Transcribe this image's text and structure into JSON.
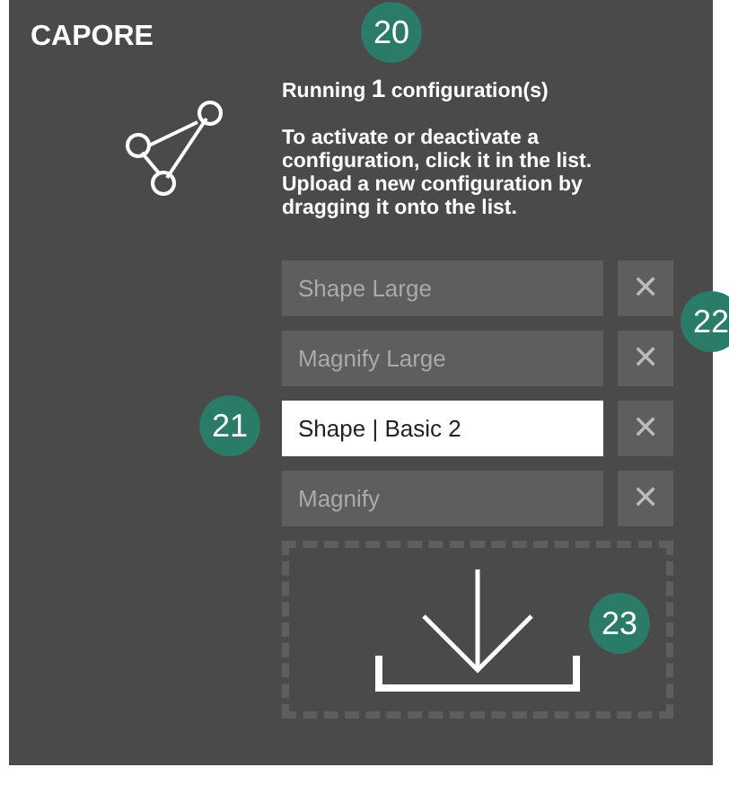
{
  "app": {
    "title": "CAPORE"
  },
  "status": {
    "prefix": "Running",
    "count": "1",
    "suffix": "configuration(s)"
  },
  "instructions": [
    "To activate or deactivate a configuration, click it in the list.",
    "Upload a new configuration by dragging it onto the list."
  ],
  "configurations": [
    {
      "name": "Shape Large",
      "selected": false,
      "remove": "✕"
    },
    {
      "name": "Magnify Large",
      "selected": false,
      "remove": "✕"
    },
    {
      "name": "Shape | Basic 2",
      "selected": true,
      "remove": "✕"
    },
    {
      "name": "Magnify",
      "selected": false,
      "remove": "✕"
    }
  ],
  "callouts": [
    "20",
    "21",
    "22",
    "23"
  ]
}
